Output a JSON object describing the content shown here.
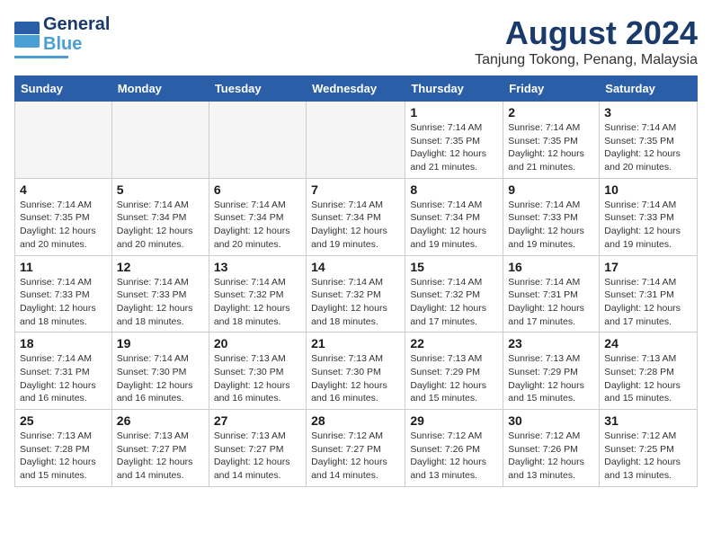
{
  "header": {
    "logo_line1": "General",
    "logo_line2": "Blue",
    "month_year": "August 2024",
    "location": "Tanjung Tokong, Penang, Malaysia"
  },
  "days_of_week": [
    "Sunday",
    "Monday",
    "Tuesday",
    "Wednesday",
    "Thursday",
    "Friday",
    "Saturday"
  ],
  "weeks": [
    [
      {
        "day": "",
        "info": ""
      },
      {
        "day": "",
        "info": ""
      },
      {
        "day": "",
        "info": ""
      },
      {
        "day": "",
        "info": ""
      },
      {
        "day": "1",
        "info": "Sunrise: 7:14 AM\nSunset: 7:35 PM\nDaylight: 12 hours\nand 21 minutes."
      },
      {
        "day": "2",
        "info": "Sunrise: 7:14 AM\nSunset: 7:35 PM\nDaylight: 12 hours\nand 21 minutes."
      },
      {
        "day": "3",
        "info": "Sunrise: 7:14 AM\nSunset: 7:35 PM\nDaylight: 12 hours\nand 20 minutes."
      }
    ],
    [
      {
        "day": "4",
        "info": "Sunrise: 7:14 AM\nSunset: 7:35 PM\nDaylight: 12 hours\nand 20 minutes."
      },
      {
        "day": "5",
        "info": "Sunrise: 7:14 AM\nSunset: 7:34 PM\nDaylight: 12 hours\nand 20 minutes."
      },
      {
        "day": "6",
        "info": "Sunrise: 7:14 AM\nSunset: 7:34 PM\nDaylight: 12 hours\nand 20 minutes."
      },
      {
        "day": "7",
        "info": "Sunrise: 7:14 AM\nSunset: 7:34 PM\nDaylight: 12 hours\nand 19 minutes."
      },
      {
        "day": "8",
        "info": "Sunrise: 7:14 AM\nSunset: 7:34 PM\nDaylight: 12 hours\nand 19 minutes."
      },
      {
        "day": "9",
        "info": "Sunrise: 7:14 AM\nSunset: 7:33 PM\nDaylight: 12 hours\nand 19 minutes."
      },
      {
        "day": "10",
        "info": "Sunrise: 7:14 AM\nSunset: 7:33 PM\nDaylight: 12 hours\nand 19 minutes."
      }
    ],
    [
      {
        "day": "11",
        "info": "Sunrise: 7:14 AM\nSunset: 7:33 PM\nDaylight: 12 hours\nand 18 minutes."
      },
      {
        "day": "12",
        "info": "Sunrise: 7:14 AM\nSunset: 7:33 PM\nDaylight: 12 hours\nand 18 minutes."
      },
      {
        "day": "13",
        "info": "Sunrise: 7:14 AM\nSunset: 7:32 PM\nDaylight: 12 hours\nand 18 minutes."
      },
      {
        "day": "14",
        "info": "Sunrise: 7:14 AM\nSunset: 7:32 PM\nDaylight: 12 hours\nand 18 minutes."
      },
      {
        "day": "15",
        "info": "Sunrise: 7:14 AM\nSunset: 7:32 PM\nDaylight: 12 hours\nand 17 minutes."
      },
      {
        "day": "16",
        "info": "Sunrise: 7:14 AM\nSunset: 7:31 PM\nDaylight: 12 hours\nand 17 minutes."
      },
      {
        "day": "17",
        "info": "Sunrise: 7:14 AM\nSunset: 7:31 PM\nDaylight: 12 hours\nand 17 minutes."
      }
    ],
    [
      {
        "day": "18",
        "info": "Sunrise: 7:14 AM\nSunset: 7:31 PM\nDaylight: 12 hours\nand 16 minutes."
      },
      {
        "day": "19",
        "info": "Sunrise: 7:14 AM\nSunset: 7:30 PM\nDaylight: 12 hours\nand 16 minutes."
      },
      {
        "day": "20",
        "info": "Sunrise: 7:13 AM\nSunset: 7:30 PM\nDaylight: 12 hours\nand 16 minutes."
      },
      {
        "day": "21",
        "info": "Sunrise: 7:13 AM\nSunset: 7:30 PM\nDaylight: 12 hours\nand 16 minutes."
      },
      {
        "day": "22",
        "info": "Sunrise: 7:13 AM\nSunset: 7:29 PM\nDaylight: 12 hours\nand 15 minutes."
      },
      {
        "day": "23",
        "info": "Sunrise: 7:13 AM\nSunset: 7:29 PM\nDaylight: 12 hours\nand 15 minutes."
      },
      {
        "day": "24",
        "info": "Sunrise: 7:13 AM\nSunset: 7:28 PM\nDaylight: 12 hours\nand 15 minutes."
      }
    ],
    [
      {
        "day": "25",
        "info": "Sunrise: 7:13 AM\nSunset: 7:28 PM\nDaylight: 12 hours\nand 15 minutes."
      },
      {
        "day": "26",
        "info": "Sunrise: 7:13 AM\nSunset: 7:27 PM\nDaylight: 12 hours\nand 14 minutes."
      },
      {
        "day": "27",
        "info": "Sunrise: 7:13 AM\nSunset: 7:27 PM\nDaylight: 12 hours\nand 14 minutes."
      },
      {
        "day": "28",
        "info": "Sunrise: 7:12 AM\nSunset: 7:27 PM\nDaylight: 12 hours\nand 14 minutes."
      },
      {
        "day": "29",
        "info": "Sunrise: 7:12 AM\nSunset: 7:26 PM\nDaylight: 12 hours\nand 13 minutes."
      },
      {
        "day": "30",
        "info": "Sunrise: 7:12 AM\nSunset: 7:26 PM\nDaylight: 12 hours\nand 13 minutes."
      },
      {
        "day": "31",
        "info": "Sunrise: 7:12 AM\nSunset: 7:25 PM\nDaylight: 12 hours\nand 13 minutes."
      }
    ]
  ]
}
